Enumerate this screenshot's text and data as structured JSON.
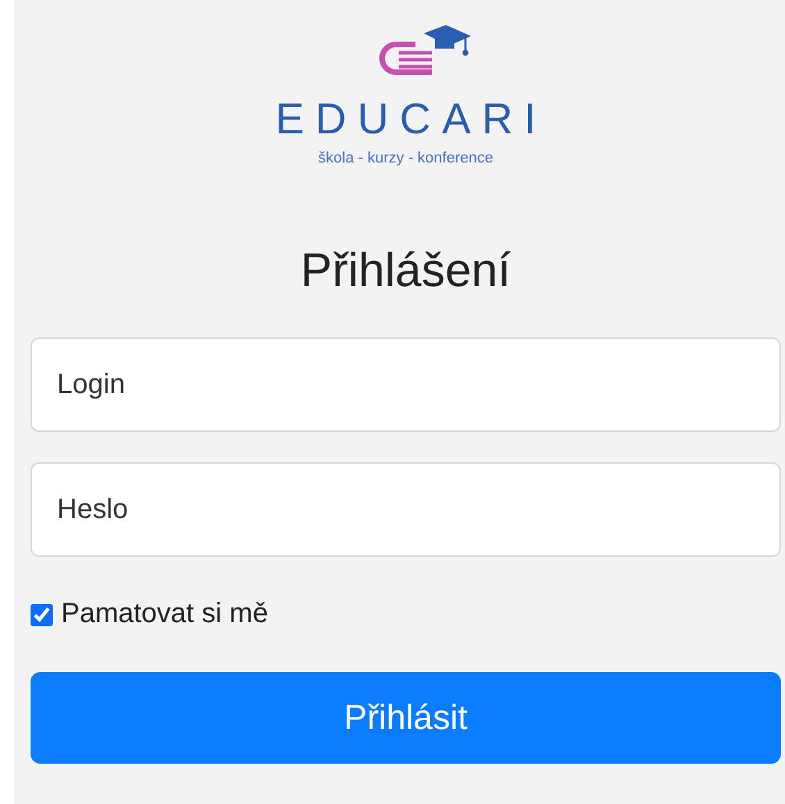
{
  "logo": {
    "name": "EDUCARI",
    "tagline": "škola - kurzy - konference"
  },
  "title": "Přihlášení",
  "fields": [
    {
      "placeholder": "Login"
    },
    {
      "placeholder": "Heslo"
    }
  ],
  "remember": {
    "label": "Pamatovat si mě",
    "checked": true
  },
  "submit": "Přihlásit"
}
